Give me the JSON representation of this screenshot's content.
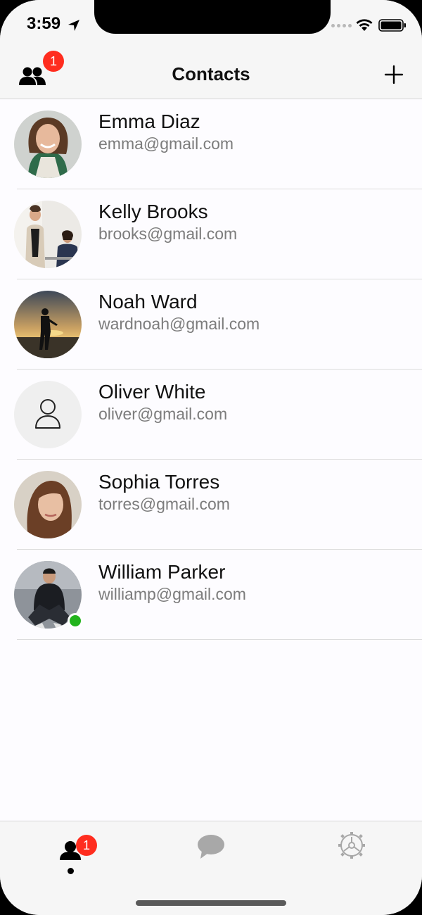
{
  "status_bar": {
    "time": "3:59"
  },
  "nav": {
    "title": "Contacts",
    "badge_count": "1",
    "left_icon": "people-icon",
    "right_icon": "plus-icon"
  },
  "contacts": [
    {
      "name": "Emma Diaz",
      "email": "emma@gmail.com",
      "avatar": "photo",
      "online": false
    },
    {
      "name": "Kelly Brooks",
      "email": "brooks@gmail.com",
      "avatar": "photo",
      "online": false
    },
    {
      "name": "Noah Ward",
      "email": "wardnoah@gmail.com",
      "avatar": "photo",
      "online": false
    },
    {
      "name": "Oliver White",
      "email": "oliver@gmail.com",
      "avatar": "placeholder-person-icon",
      "online": false
    },
    {
      "name": "Sophia Torres",
      "email": "torres@gmail.com",
      "avatar": "photo",
      "online": false
    },
    {
      "name": "William Parker",
      "email": "williamp@gmail.com",
      "avatar": "photo",
      "online": true
    }
  ],
  "tab_bar": {
    "tabs": [
      {
        "icon": "person-icon",
        "badge": "1",
        "selected": true
      },
      {
        "icon": "chat-bubble-icon",
        "selected": false
      },
      {
        "icon": "settings-wheel-icon",
        "selected": false
      }
    ]
  },
  "colors": {
    "badge": "#ff2d1f",
    "online": "#22b31c",
    "email_text": "#7c7c7c"
  }
}
